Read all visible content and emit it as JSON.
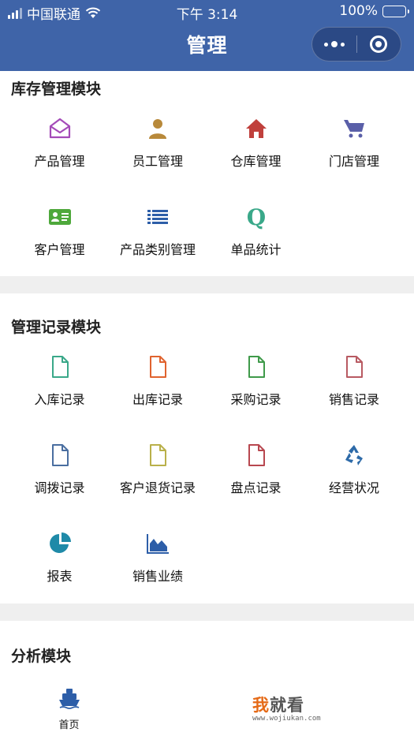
{
  "status_bar": {
    "carrier": "中国联通",
    "time": "下午 3:14",
    "battery": "100%"
  },
  "nav": {
    "title": "管理"
  },
  "sections": [
    {
      "title": "库存管理模块",
      "items": [
        {
          "label": "产品管理",
          "icon": "envelope-open-icon",
          "color": "#a44bb8"
        },
        {
          "label": "员工管理",
          "icon": "user-icon",
          "color": "#b8893a"
        },
        {
          "label": "仓库管理",
          "icon": "home-icon",
          "color": "#c0403c"
        },
        {
          "label": "门店管理",
          "icon": "shopping-cart-icon",
          "color": "#5a5fa8"
        },
        {
          "label": "客户管理",
          "icon": "id-card-icon",
          "color": "#4ea83b"
        },
        {
          "label": "产品类别管理",
          "icon": "list-icon",
          "color": "#2d5ea8"
        },
        {
          "label": "单品统计",
          "icon": "q-letter-icon",
          "color": "#3aa889"
        }
      ]
    },
    {
      "title": "管理记录模块",
      "items": [
        {
          "label": "入库记录",
          "icon": "document-icon",
          "color": "#3aa889"
        },
        {
          "label": "出库记录",
          "icon": "document-icon",
          "color": "#e0632f"
        },
        {
          "label": "采购记录",
          "icon": "document-icon",
          "color": "#3f9a4a"
        },
        {
          "label": "销售记录",
          "icon": "document-icon",
          "color": "#b85a62"
        },
        {
          "label": "调拨记录",
          "icon": "document-icon",
          "color": "#4a6ea0"
        },
        {
          "label": "客户退货记录",
          "icon": "document-icon",
          "color": "#b9b04a"
        },
        {
          "label": "盘点记录",
          "icon": "document-icon",
          "color": "#b8474f"
        },
        {
          "label": "经营状况",
          "icon": "recycle-icon",
          "color": "#2d6aa8"
        },
        {
          "label": "报表",
          "icon": "pie-chart-icon",
          "color": "#1f8aa8"
        },
        {
          "label": "销售业绩",
          "icon": "area-chart-icon",
          "color": "#2d5ea8"
        }
      ]
    },
    {
      "title": "分析模块",
      "items": []
    }
  ],
  "tab_bar": {
    "home_label": "首页",
    "home_icon": "ship-icon",
    "home_color": "#2d5ea8"
  },
  "watermark": {
    "first_char": "我",
    "rest": "就看",
    "url": "www.wojiukan.com"
  }
}
